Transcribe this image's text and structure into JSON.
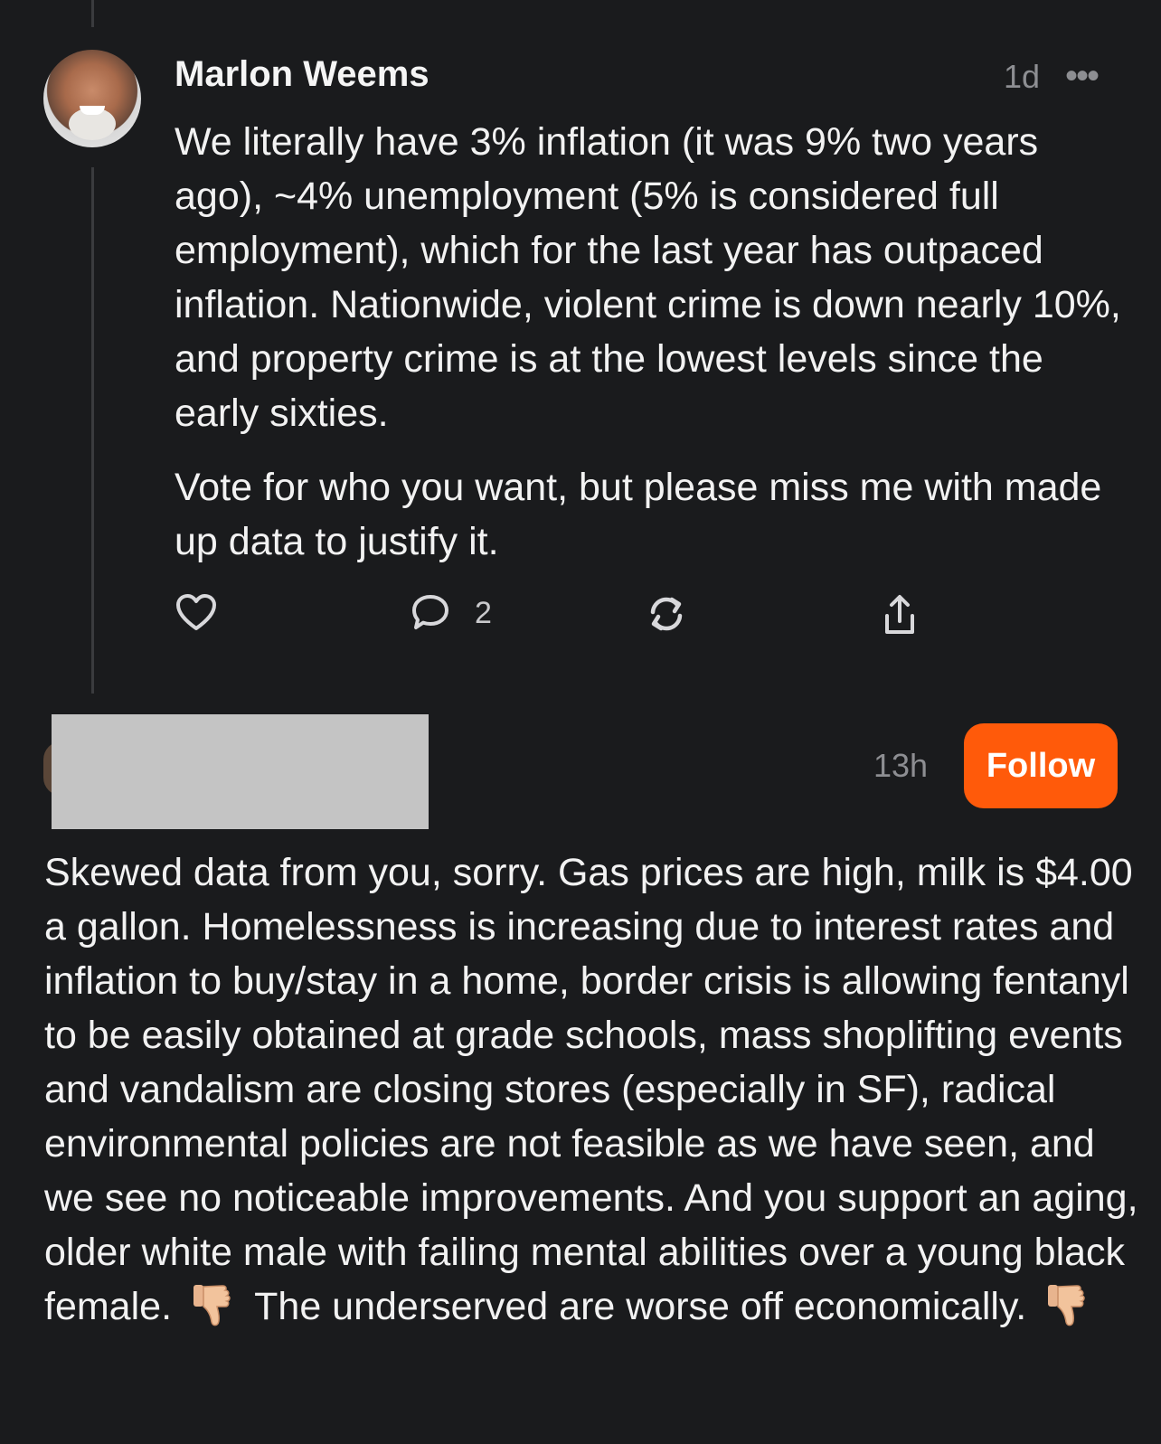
{
  "post": {
    "author": "Marlon Weems",
    "time": "1d",
    "more_label": "•••",
    "paragraphs": [
      "We literally have 3% inflation (it was 9% two years ago), ~4% unemployment (5% is considered full employment), which for the last year has outpaced inflation. Nationwide, violent crime is down nearly 10%, and property crime is at the lowest levels since the early sixties.",
      "Vote for who you want, but please miss me with made up data to justify it."
    ],
    "actions": {
      "like_icon": "heart-icon",
      "reply_icon": "speech-bubble-icon",
      "reply_count": "2",
      "repost_icon": "repost-icon",
      "share_icon": "share-icon"
    }
  },
  "reply": {
    "time": "13h",
    "follow_label": "Follow",
    "text_part1": "Skewed data from you, sorry. Gas prices are high, milk is $4.00 a gallon. Homelessness is increasing due to interest rates and inflation to buy/stay in a home, border crisis is allowing fentanyl to be easily obtained at grade schools, mass shoplifting events and vandalism are closing stores (especially in SF), radical environmental policies are not feasible as we have seen, and we see no noticeable improvements. And you support an aging, older white male with failing mental abilities over a young black female.",
    "text_part2": "The underserved are worse off economically.",
    "emoji_icon": "thumbs-down-icon"
  },
  "colors": {
    "background": "#1a1b1d",
    "text": "#f2f2f2",
    "muted": "#8d8e92",
    "accent": "#ff5a0a",
    "redaction": "#c4c4c4"
  }
}
